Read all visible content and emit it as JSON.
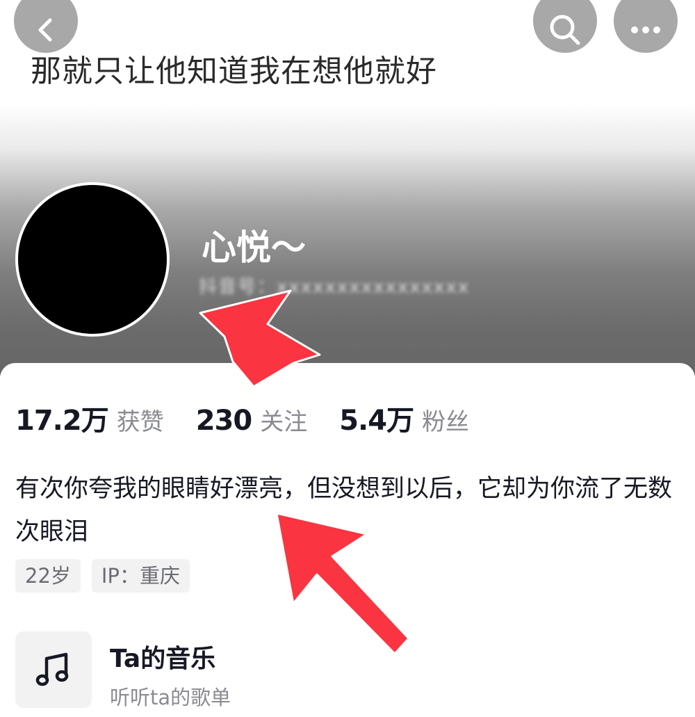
{
  "header": {
    "signature": "那就只让他知道我在想他就好",
    "back_icon": "chevron-left-icon",
    "search_icon": "search-icon",
    "more_icon": "more-horizontal-icon",
    "gradient_color": "#666666"
  },
  "profile": {
    "nickname": "心悦～",
    "user_id_blurred": "抖音号：xxxxxxxxxxxxxxxx"
  },
  "stats": [
    {
      "value": "17.2万",
      "label": "获赞"
    },
    {
      "value": "230",
      "label": "关注"
    },
    {
      "value": "5.4万",
      "label": "粉丝"
    }
  ],
  "bio": "有次你夸我的眼睛好漂亮，但没想到以后，它却为你流了无数次眼泪",
  "tags": [
    {
      "label": "22岁"
    },
    {
      "label": "IP：重庆"
    }
  ],
  "music": {
    "icon": "music-note-icon",
    "title": "Ta的音乐",
    "subtitle": "听听ta的歌单"
  },
  "annotations": {
    "arrow_color": "#fa3440"
  }
}
